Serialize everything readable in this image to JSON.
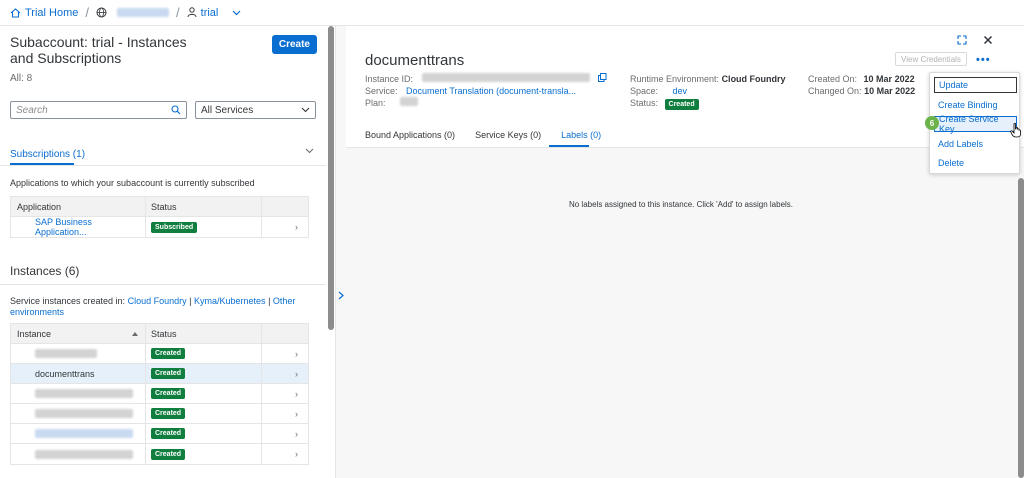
{
  "breadcrumb": {
    "home": "Trial Home",
    "space": "trial"
  },
  "left": {
    "title": "Subaccount: trial - Instances and Subscriptions",
    "count": "All: 8",
    "create_label": "Create",
    "search_placeholder": "Search",
    "filter_value": "All Services",
    "subscriptions_tab": "Subscriptions (1)",
    "subscriptions_desc": "Applications to which your subaccount is currently subscribed",
    "subscriptions_table": {
      "headers": [
        "Application",
        "Status"
      ],
      "rows": [
        {
          "name": "SAP Business Application...",
          "status": "Subscribed"
        }
      ]
    },
    "instances_title": "Instances (6)",
    "instances_desc_prefix": "Service instances created in:",
    "instances_desc_link1": "Cloud Foundry",
    "instances_desc_sep": "|",
    "instances_desc_link2": "Kyma/Kubernetes",
    "instances_desc_link3": "Other environments",
    "instances_table": {
      "headers": [
        "Instance",
        "Status"
      ],
      "rows": [
        {
          "name": "",
          "status": "Created"
        },
        {
          "name": "documenttrans",
          "status": "Created"
        },
        {
          "name": "",
          "status": "Created"
        },
        {
          "name": "",
          "status": "Created"
        },
        {
          "name": "",
          "status": "Created"
        },
        {
          "name": "",
          "status": "Created"
        }
      ]
    }
  },
  "detail": {
    "title": "documenttrans",
    "instance_id_label": "Instance ID:",
    "service_label": "Service:",
    "service_value": "Document Translation (document-transla...",
    "plan_label": "Plan:",
    "runtime_label": "Runtime Environment:",
    "runtime_value": "Cloud Foundry",
    "space_label": "Space:",
    "space_value": "dev",
    "status_label": "Status:",
    "status_value": "Created",
    "created_label": "Created On:",
    "created_value": "10 Mar 2022",
    "changed_label": "Changed On:",
    "changed_value": "10 Mar 2022",
    "view_credentials": "View Credentials",
    "tabs": [
      "Bound Applications (0)",
      "Service Keys (0)",
      "Labels (0)"
    ],
    "empty_message": "No labels assigned to this instance. Click 'Add' to assign labels."
  },
  "menu": {
    "items": [
      "Update",
      "Create Binding",
      "Create Service Key",
      "Add Labels",
      "Delete"
    ]
  },
  "step_badge": "6",
  "colors": {
    "accent": "#0a6ed1",
    "success": "#107e3e",
    "step": "#6bb34a"
  }
}
